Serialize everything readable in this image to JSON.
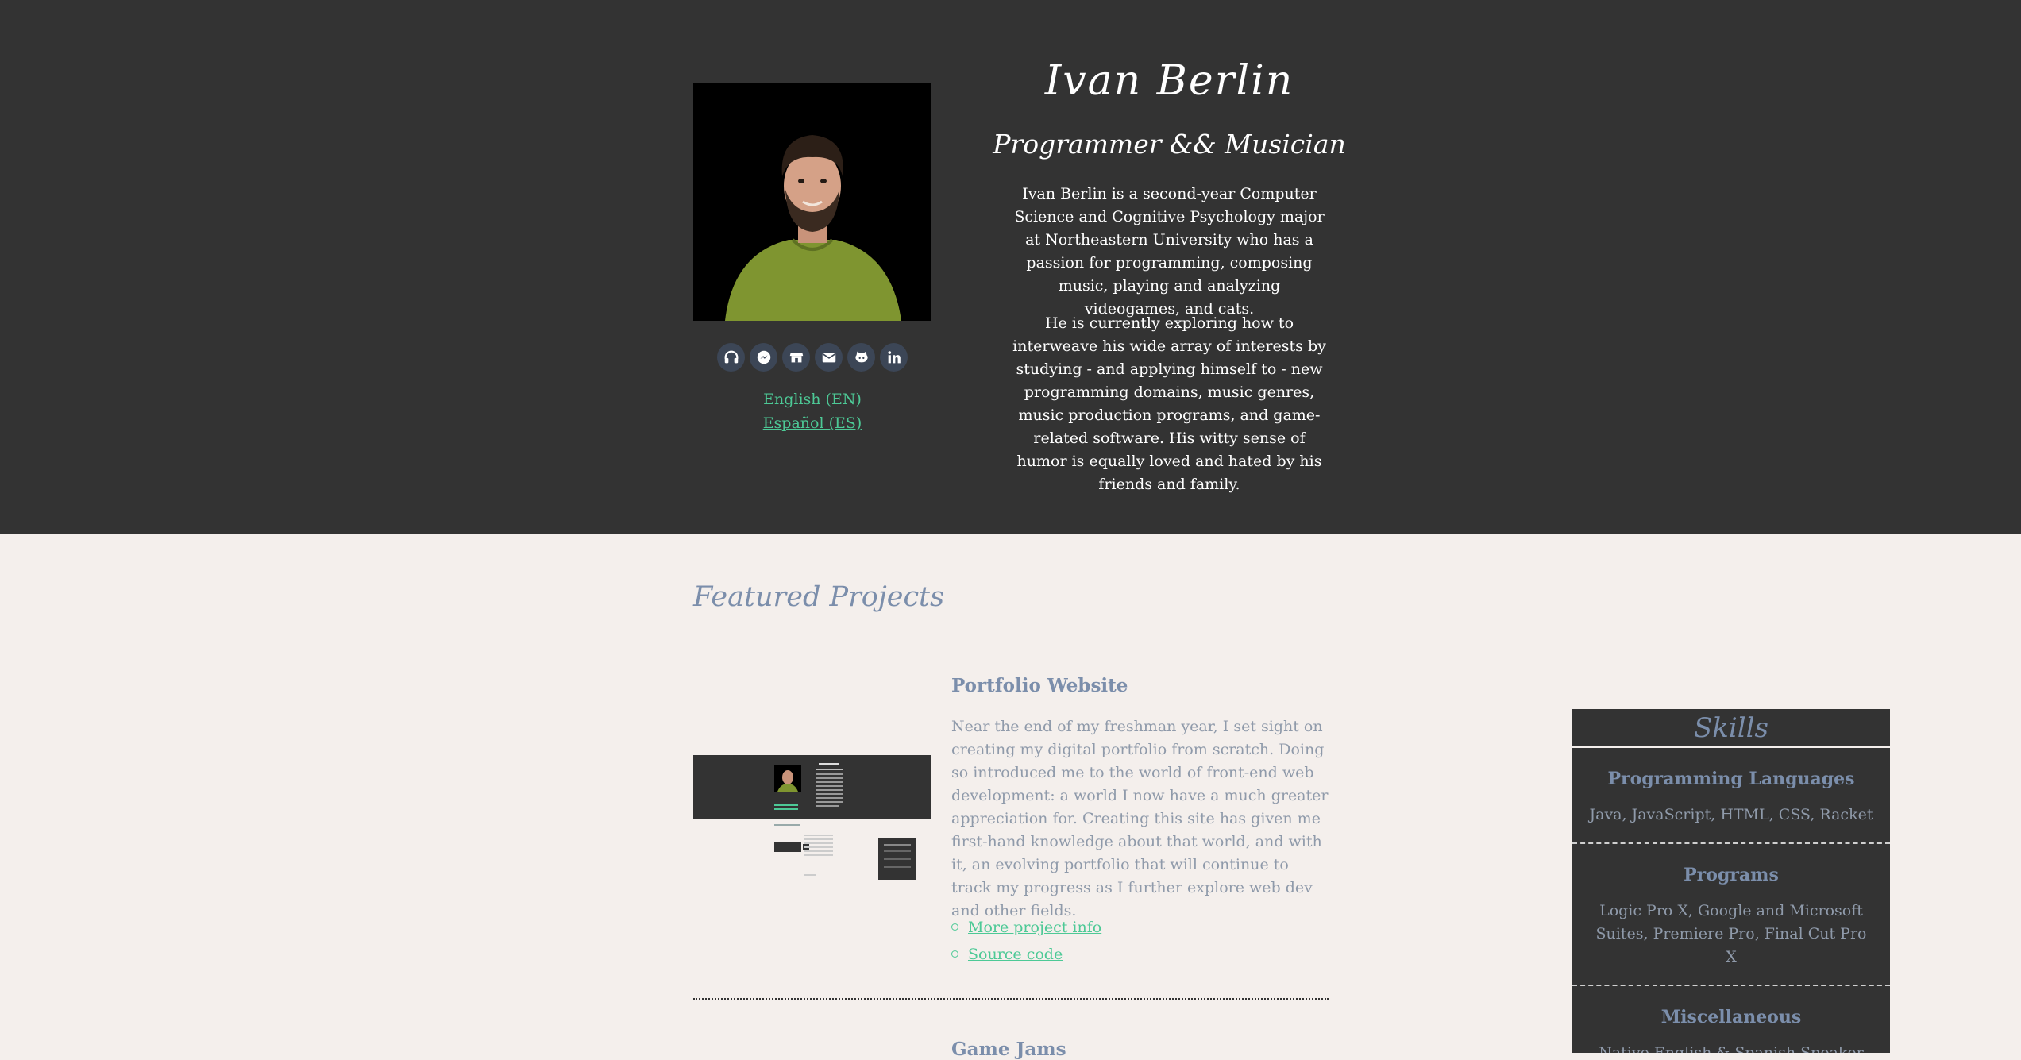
{
  "hero": {
    "name": "Ivan Berlin",
    "subtitle": "Programmer && Musician",
    "bio_paragraphs": [
      "Ivan Berlin is a second-year Computer Science and Cognitive Psychology major at Northeastern University who has a passion for programming, composing music, playing and analyzing videogames, and cats.",
      "He is currently exploring how to interweave his wide array of interests by studying - and applying himself to - new programming domains, music genres, music production programs, and game-related software. His witty sense of humor is equally loved and hated by his friends and family."
    ],
    "social_icons": [
      "headphones-icon",
      "messenger-icon",
      "store-icon",
      "mail-icon",
      "github-icon",
      "linkedin-icon"
    ],
    "languages": [
      {
        "label": "English (EN)",
        "active": true
      },
      {
        "label": "Español (ES)",
        "active": false
      }
    ]
  },
  "featured": {
    "heading": "Featured Projects",
    "projects": [
      {
        "title": "Portfolio Website",
        "description": "Near the end of my freshman year, I set sight on creating my digital portfolio from scratch. Doing so introduced me to the world of front-end web development: a world I now have a much greater appreciation for. Creating this site has given me first-hand knowledge about that world, and with it, an evolving portfolio that will continue to track my progress as I further explore web dev and other fields.",
        "links": [
          "More project info",
          "Source code"
        ]
      },
      {
        "title": "Game Jams"
      }
    ]
  },
  "skills": {
    "heading": "Skills",
    "sections": [
      {
        "title": "Programming Languages",
        "body": "Java, JavaScript, HTML, CSS, Racket"
      },
      {
        "title": "Programs",
        "body": "Logic Pro X, Google and Microsoft Suites, Premiere Pro, Final Cut Pro X"
      },
      {
        "title": "Miscellaneous",
        "body": "Native English & Spanish Speaker"
      }
    ]
  },
  "colors": {
    "dark_bg": "#333333",
    "light_bg": "#f4efec",
    "accent_green": "#4dc996",
    "heading_blue": "#7b8eab",
    "body_gray": "#8f9aaa"
  }
}
